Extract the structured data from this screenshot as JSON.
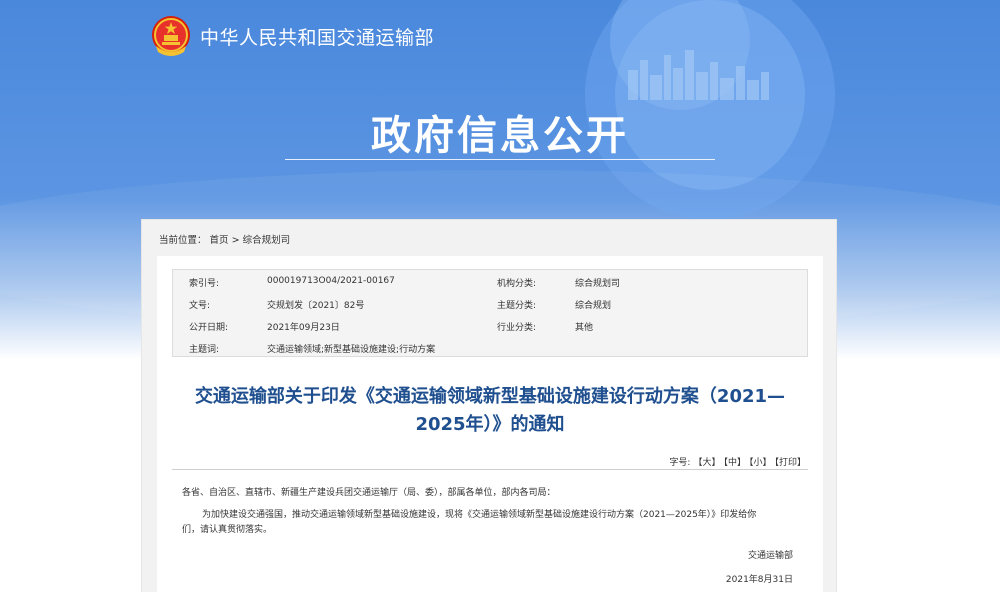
{
  "header": {
    "site_name": "中华人民共和国交通运输部",
    "page_title": "政府信息公开"
  },
  "breadcrumb": {
    "prefix": "当前位置：",
    "home": "首页",
    "separator": ">",
    "section": "综合规划司"
  },
  "meta": {
    "index_label": "索引号:",
    "index_value": "000019713O04/2021-00167",
    "org_label": "机构分类:",
    "org_value": "综合规划司",
    "docno_label": "文号:",
    "docno_value": "交规划发〔2021〕82号",
    "topic_label": "主题分类:",
    "topic_value": "综合规划",
    "date_label": "公开日期:",
    "date_value": "2021年09月23日",
    "industry_label": "行业分类:",
    "industry_value": "其他",
    "keywords_label": "主题词:",
    "keywords_value": "交通运输领域;新型基础设施建设;行动方案"
  },
  "document": {
    "title_line1": "交通运输部关于印发《交通运输领域新型基础设施建设行动方案（2021—",
    "title_line2": "2025年）》的通知",
    "font_size_label": "字号:",
    "font_large": "【大】",
    "font_medium": "【中】",
    "font_small": "【小】",
    "print": "【打印】",
    "salutation": "各省、自治区、直辖市、新疆生产建设兵团交通运输厅（局、委），部属各单位，部内各司局：",
    "paragraph_line1": "为加快建设交通强国，推动交通运输领域新型基础设施建设，现将《交通运输领域新型基础设施建设行动方案（2021—2025年）》印发给你",
    "paragraph_line2": "们，请认真贯彻落实。",
    "signature": "交通运输部",
    "sign_date": "2021年8月31日"
  },
  "colors": {
    "banner_blue": "#4a88dc",
    "title_blue": "#1f4f8f"
  }
}
